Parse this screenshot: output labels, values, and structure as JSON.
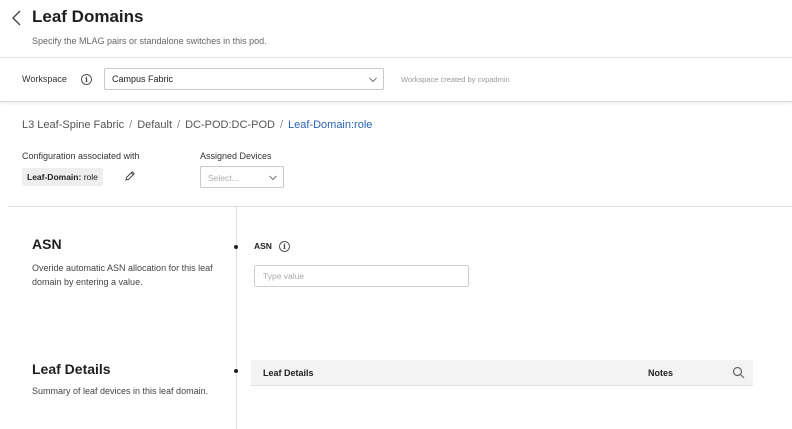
{
  "header": {
    "title": "Leaf Domains",
    "subtitle": "Specify the MLAG pairs or standalone switches in this pod."
  },
  "workspace": {
    "label": "Workspace",
    "selected": "Campus Fabric",
    "note": "Workspace created by cvpadmin"
  },
  "breadcrumb": {
    "items": [
      "L3 Leaf-Spine Fabric",
      "Default",
      "DC-POD:DC-POD",
      "Leaf-Domain:role"
    ],
    "separator": "/"
  },
  "config": {
    "label": "Configuration associated with",
    "tag_key": "Leaf-Domain:",
    "tag_value": "role"
  },
  "assigned": {
    "label": "Assigned Devices",
    "placeholder": "Select..."
  },
  "asn_section": {
    "title": "ASN",
    "description": "Overide automatic ASN allocation for this leaf domain by entering a value.",
    "field_label": "ASN",
    "input_value": "",
    "input_placeholder": "Type value"
  },
  "leaf_section": {
    "title": "Leaf Details",
    "description": "Summary of leaf devices in this leaf domain.",
    "columns": [
      "Leaf Details",
      "Notes"
    ]
  },
  "icons": {
    "back": "chevron-left-icon",
    "info": "info-icon",
    "dropdown": "chevron-down-icon",
    "edit": "pencil-icon",
    "search": "search-icon"
  },
  "colors": {
    "link": "#2a62b4",
    "table_header_bg": "#f3f3f3",
    "divider": "#dedede"
  }
}
